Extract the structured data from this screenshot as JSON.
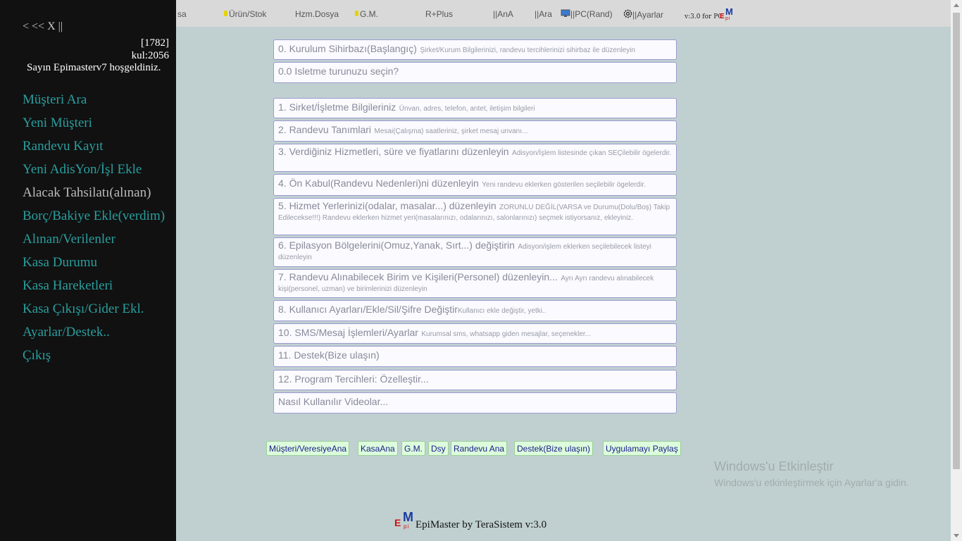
{
  "topbar": {
    "items": [
      {
        "label": "sa",
        "dot": false
      },
      {
        "label": "Ürün/Stok",
        "dot": true
      },
      {
        "label": "Hzm.Dosya",
        "dot": false
      },
      {
        "label": "G.M.",
        "dot": true
      },
      {
        "label": "R+Plus",
        "dot": false
      },
      {
        "label": "||AnA",
        "dot": false
      },
      {
        "label": "||Ara",
        "dot": false
      },
      {
        "label": "||PC(Rand)",
        "icon": "monitor-icon"
      },
      {
        "label": "||Ayarlar",
        "icon": "gear-icon"
      }
    ],
    "version": "v:3.0 for PC",
    "logo": {
      "big": "M",
      "left": "E",
      "small": "pi"
    }
  },
  "sidebar": {
    "close": "< << X ||",
    "id": "[1782]",
    "user_code": "kul:2056",
    "welcome_prefix": "Sayın ",
    "welcome_name": "Epimasterv7",
    "welcome_suffix": " hoşgeldiniz.",
    "items": [
      "Müşteri Ara",
      "Yeni Müşteri",
      "Randevu Kayıt",
      "Yeni AdisYon/İşl Ekle",
      "Alacak Tahsilatı(alınan)",
      "Borç/Bakiye Ekle(verdim)",
      "Alınan/Verilenler",
      "Kasa Durumu",
      "Kasa Hareketleri",
      "Kasa Çıkışı/Gider Ekl.",
      "Ayarlar/Destek..",
      "Çıkış"
    ]
  },
  "menu": [
    {
      "title": "0. Kurulum Sihirbazı(Başlangıç)",
      "sub": "Şirket/Kurum Bilgilerinizi, randevu tercihlerinizi sihirbaz ile düzenleyin"
    },
    {
      "title": "0.0 Isletme turunuzu seçin?",
      "sub": ""
    },
    {
      "title": "1. Sirket/İşletme Bilgileriniz",
      "sub": "Ünvan, adres, telefon, antet, iletişim bilgileri"
    },
    {
      "title": "2. Randevu Tanımlari",
      "sub": "Mesai(Çalışma) saatleriniz, şirket mesaj unvanı..."
    },
    {
      "title": "3. Verdiğiniz Hizmetleri, süre ve fiyatlarını düzenleyin",
      "sub": "Adisyon/İşlem listesinde çıkan SEÇilebilir ögelerdir."
    },
    {
      "title": "4. Ön Kabul(Randevu Nedenleri)ni düzenleyin",
      "sub": "Yeni randevu eklerken gösterilen seçilebilir ögelerdir."
    },
    {
      "title": "5. Hizmet Yerlerinizi(odalar, masalar...) düzenleyin",
      "sub": "ZORUNLU DEĞİL(VARSA ve Durumu(Dolu/Boş) Takip Edilecekse!!!) Randevu eklerken hizmet yeri(masalarınızı, odalarınızı, salonlarınızı) seçmek istiyorsanız, ekleyiniz."
    },
    {
      "title": "6. Epilasyon Bölgelerini(Omuz,Yanak, Sırt...) değiştirin",
      "sub": "Adisyon/işlem eklerken seçilebilecek listeyi düzenleyin"
    },
    {
      "title": "7. Randevu Alınabilecek Birim ve Kişileri(Personel) düzenleyin...",
      "sub": "Ayrı Ayrı randevu alınabilecek kişi(personel, uzman) ve birimlerinizi düzenleyin"
    },
    {
      "title": "8. Kullanıcı Ayarları/Ekle/Sil/Şifre Değiştir",
      "sub": "Kullanıcı ekle değiştir, yetki.."
    },
    {
      "title": "10. SMS/Mesaj İşlemleri/Ayarlar",
      "sub": "Kurumsal sms, whatsapp giden mesajlar, seçenekler..."
    },
    {
      "title": "11. Destek(Bize ulaşın)",
      "sub": ""
    },
    {
      "title": "12. Program Tercihleri: Özelleştir...",
      "sub": ""
    },
    {
      "title": "Nasıl Kullanılır Videolar...",
      "sub": ""
    }
  ],
  "bottom_links": [
    "Müşteri/VeresiyeAna",
    "KasaAna",
    "G.M.",
    "Dsy",
    "Randevu Ana",
    "Destek(Bize ulaşın)",
    "Uygulamayı Paylaş"
  ],
  "footer": {
    "text": "EpiMaster by TeraSistem v:3.0",
    "logo": {
      "big": "M",
      "left": "E",
      "small": "pi"
    }
  },
  "activation": {
    "heading": "Windows'u Etkinleştir",
    "body": "Windows'u etkinleştirmek için Ayarlar'a gidin."
  },
  "colors": {
    "sidebar_bg": "#111111",
    "sidebar_link": "#2a9e9e",
    "page_bg": "#c0d0d0",
    "row_border": "#9a9ad0",
    "link_bg": "#dcfcdc"
  }
}
